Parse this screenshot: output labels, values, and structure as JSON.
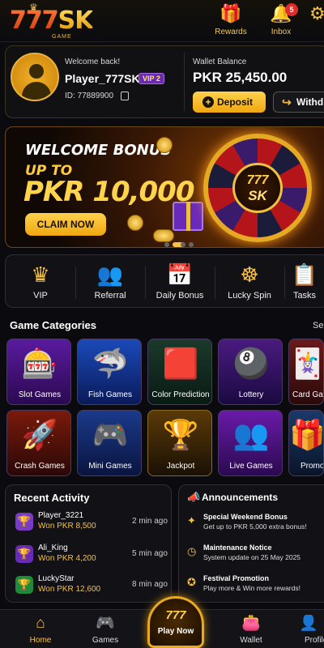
{
  "header": {
    "logo": {
      "digits": "777",
      "letters": "SK",
      "sub": "GAME"
    },
    "rewards_label": "Rewards",
    "inbox_label": "Inbox",
    "inbox_count": "5"
  },
  "profile": {
    "welcome": "Welcome back!",
    "username": "Player_777SK",
    "vip": "VIP 2",
    "id_text": "ID: 77889900",
    "wallet_label": "Wallet Balance",
    "wallet_amount": "PKR 25,450.00",
    "deposit_label": "Deposit",
    "withdraw_label": "Withdraw"
  },
  "banner": {
    "title": "WELCOME BONUS",
    "upto": "UP TO",
    "amount": "PKR 10,000",
    "claim_label": "CLAIM NOW",
    "wheel_top": "777",
    "wheel_bottom": "SK",
    "active_slide": 1,
    "slide_count": 4
  },
  "quick_access": [
    {
      "label": "VIP",
      "icon": "crown-icon"
    },
    {
      "label": "Referral",
      "icon": "users-icon"
    },
    {
      "label": "Daily Bonus",
      "icon": "calendar-icon"
    },
    {
      "label": "Lucky Spin",
      "icon": "wheel-icon"
    },
    {
      "label": "Tasks",
      "icon": "task-icon"
    }
  ],
  "categories": {
    "title": "Game Categories",
    "see_all": "See All",
    "items": [
      {
        "label": "Slot Games",
        "icon": "slot-machine-icon"
      },
      {
        "label": "Fish Games",
        "icon": "shark-icon"
      },
      {
        "label": "Color Prediction",
        "icon": "cubes-icon"
      },
      {
        "label": "Lottery",
        "icon": "lottery-balls-icon"
      },
      {
        "label": "Card Games",
        "icon": "cards-icon"
      },
      {
        "label": "Crash Games",
        "icon": "rocket-icon"
      },
      {
        "label": "Mini Games",
        "icon": "gamepad-icon"
      },
      {
        "label": "Jackpot",
        "icon": "jackpot-trophy-icon"
      },
      {
        "label": "Live Games",
        "icon": "live-users-icon"
      },
      {
        "label": "Promotions",
        "icon": "gift-icon"
      }
    ]
  },
  "recent": {
    "title": "Recent Activity",
    "items": [
      {
        "name": "Player_3221",
        "won": "Won PKR 8,500",
        "time": "2 min ago",
        "color": "#7a3ac8"
      },
      {
        "name": "Ali_King",
        "won": "Won PKR 4,200",
        "time": "5 min ago",
        "color": "#6a2ab8"
      },
      {
        "name": "LuckyStar",
        "won": "Won PKR 12,600",
        "time": "8 min ago",
        "color": "#1f8a3a"
      }
    ]
  },
  "announcements": {
    "title": "Announcements",
    "items": [
      {
        "title": "Special Weekend Bonus",
        "subtitle": "Get up to PKR 5,000 extra bonus!"
      },
      {
        "title": "Maintenance Notice",
        "subtitle": "System update on 25 May 2025"
      },
      {
        "title": "Festival  Promotion",
        "subtitle": "Play more & Win more rewards!"
      }
    ]
  },
  "nav": {
    "home": "Home",
    "games": "Games",
    "play_top": "777",
    "play_now": "Play Now",
    "wallet": "Wallet",
    "profile": "Profile",
    "active": "home"
  },
  "colors": {
    "accent": "#f5c043",
    "background": "#0b0b0f",
    "vip": "#6a2ca8"
  }
}
